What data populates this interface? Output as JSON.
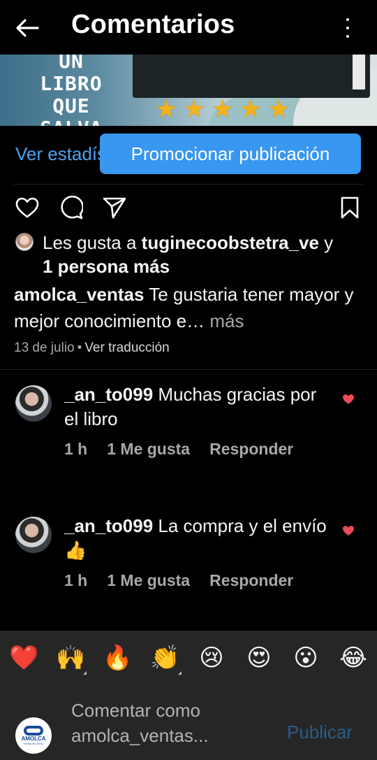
{
  "header": {
    "title": "Comentarios"
  },
  "banner": {
    "text": "UN LIBRO QUE SALVA VIDAS",
    "rating": 5
  },
  "promote": {
    "insights_label": "Ver estadísticas",
    "promote_label": "Promocionar publicación"
  },
  "likes": {
    "prefix": "Les gusta a ",
    "user": "tuginecoobstetra_ve",
    "connector": " y",
    "others": "1 persona más"
  },
  "caption": {
    "user": "amolca_ventas",
    "text": " Te gustaria tener mayor y mejor conocimiento e…",
    "more_label": " más",
    "date": "13 de julio",
    "separator": "•",
    "translate_label": "Ver traducción"
  },
  "comments": [
    {
      "user": "_an_to099",
      "text": " Muchas gracias por el libro",
      "time": "1 h",
      "likes": "1 Me gusta",
      "reply_label": "Responder"
    },
    {
      "user": "_an_to099",
      "text": " La compra y el envío 👍",
      "time": "1 h",
      "likes": "1 Me gusta",
      "reply_label": "Responder"
    }
  ],
  "reactions": [
    "❤️",
    "🙌",
    "🔥",
    "👏",
    "😢",
    "😍",
    "😮",
    "😂"
  ],
  "compose": {
    "placeholder": "Comentar como amolca_ventas...",
    "publish_label": "Publicar",
    "avatar_logo": "AMOLCA",
    "avatar_sub": "Venta de Libros"
  },
  "colors": {
    "background": "#000000",
    "link_blue": "#4aa3f0",
    "promote_blue": "#3897f0",
    "heart_red": "#ed4956",
    "star_gold": "#f2b31d",
    "bar_gray": "#262626"
  },
  "icons": [
    "back-arrow-icon",
    "more-vertical-icon",
    "heart-icon",
    "comment-icon",
    "share-icon",
    "bookmark-icon",
    "heart-filled-icon"
  ]
}
